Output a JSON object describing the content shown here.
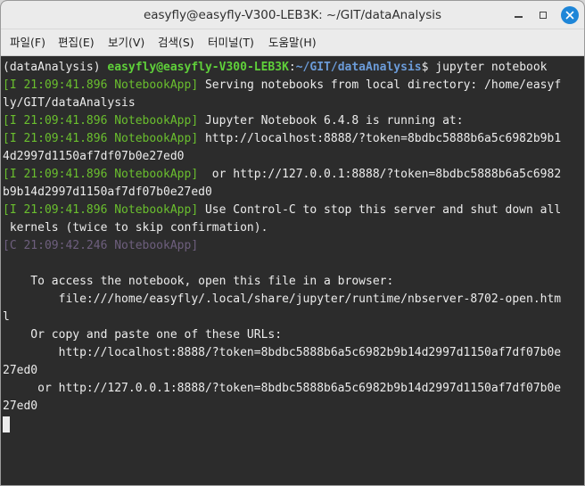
{
  "window": {
    "title": "easyfly@easyfly-V300-LEB3K: ~/GIT/dataAnalysis"
  },
  "menu": [
    "파일(F)",
    "편집(E)",
    "보기(V)",
    "검색(S)",
    "터미널(T)",
    "도움말(H)"
  ],
  "terminal": {
    "prompt": {
      "env": "(dataAnalysis) ",
      "user_host": "easyfly@easyfly-V300-LEB3K",
      "colon": ":",
      "path": "~/GIT/dataAnalysis",
      "symbol": "$ ",
      "command": "jupyter notebook"
    },
    "log": [
      {
        "tag": "[I 21:09:41.896 NotebookApp]",
        "msg": " Serving notebooks from local directory: /home/easyf"
      },
      {
        "tag": "",
        "msg": "ly/GIT/dataAnalysis"
      },
      {
        "tag": "[I 21:09:41.896 NotebookApp]",
        "msg": " Jupyter Notebook 6.4.8 is running at:"
      },
      {
        "tag": "[I 21:09:41.896 NotebookApp]",
        "msg": " http://localhost:8888/?token=8bdbc5888b6a5c6982b9b1"
      },
      {
        "tag": "",
        "msg": "4d2997d1150af7df07b0e27ed0"
      },
      {
        "tag": "[I 21:09:41.896 NotebookApp]",
        "msg": "  or http://127.0.0.1:8888/?token=8bdbc5888b6a5c6982"
      },
      {
        "tag": "",
        "msg": "b9b14d2997d1150af7df07b0e27ed0"
      },
      {
        "tag": "[I 21:09:41.896 NotebookApp]",
        "msg": " Use Control-C to stop this server and shut down all"
      },
      {
        "tag": "",
        "msg": " kernels (twice to skip confirmation)."
      }
    ],
    "critical_tag": "[C 21:09:42.246 NotebookApp]",
    "body": [
      "",
      "    To access the notebook, open this file in a browser:",
      "        file:///home/easyfly/.local/share/jupyter/runtime/nbserver-8702-open.htm",
      "l",
      "    Or copy and paste one of these URLs:",
      "        http://localhost:8888/?token=8bdbc5888b6a5c6982b9b14d2997d1150af7df07b0e",
      "27ed0",
      "     or http://127.0.0.1:8888/?token=8bdbc5888b6a5c6982b9b14d2997d1150af7df07b0e",
      "27ed0"
    ]
  },
  "colors": {
    "terminal_bg": "#2c2c2c",
    "log_tag": "#6abf2e",
    "prompt_user": "#5fd03a",
    "prompt_path": "#6b9bd8",
    "close_button": "#1e86d8"
  },
  "icons": [
    "minimize-icon",
    "maximize-icon",
    "close-icon"
  ]
}
